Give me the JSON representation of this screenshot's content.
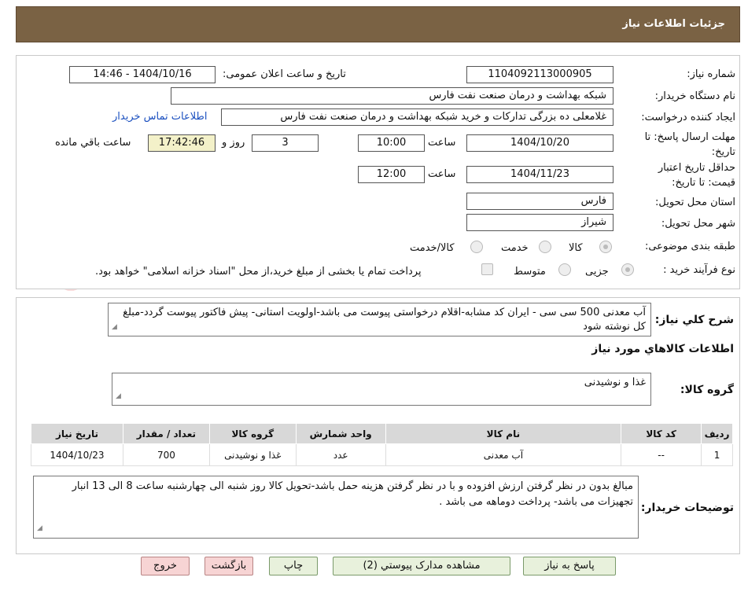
{
  "header": {
    "title": "جزئیات اطلاعات نیاز"
  },
  "form": {
    "need_number_label": "شماره نیاز:",
    "need_number": "1104092113000905",
    "announce_label": "تاریخ و ساعت اعلان عمومی:",
    "announce_value": "1404/10/16 - 14:46",
    "buyer_name_label": "نام دستگاه خریدار:",
    "buyer_name": "شبکه بهداشت و درمان صنعت نفت فارس",
    "creator_label": "ایجاد کننده درخواست:",
    "creator": "غلامعلی ده بزرگی تدارکات و خرید شبکه بهداشت و درمان صنعت نفت فارس",
    "contact_link": "اطلاعات تماس خریدار",
    "deadline_label_1": "مهلت ارسال پاسخ: تا",
    "deadline_label_2": "تاریخ:",
    "deadline_date": "1404/10/20",
    "time_label": "ساعت",
    "deadline_time": "10:00",
    "days_value": "3",
    "days_label": "روز و",
    "remaining_time": "17:42:46",
    "remaining_label": "ساعت باقي مانده",
    "validity_label_1": "حداقل تاریخ اعتبار",
    "validity_label_2": "قیمت: تا تاریخ:",
    "validity_date": "1404/11/23",
    "validity_time": "12:00",
    "province_label": "استان محل تحویل:",
    "province": "فارس",
    "city_label": "شهر محل تحویل:",
    "city": "شیراز",
    "category_label": "طبقه بندی موضوعی:",
    "category_options": [
      "کالا",
      "خدمت",
      "کالا/خدمت"
    ],
    "purchase_type_label": "نوع فرآیند خرید :",
    "purchase_options": [
      "جزیی",
      "متوسط"
    ],
    "treasury_note": "پرداخت تمام یا بخشی از مبلغ خرید،از محل \"اسناد خزانه اسلامی\" خواهد بود."
  },
  "summary": {
    "label": "شرح کلي نياز:",
    "text": "آب معدنی 500 سی سی - ایران کد مشابه-اقلام درخواستی پیوست می باشد-اولویت استانی- پیش فاکتور پیوست گردد-مبلغ کل نوشته شود"
  },
  "goods": {
    "section_title": "اطلاعات کالاهاي مورد نياز",
    "group_label": "گروه کالا:",
    "group_value": "غذا و نوشیدنی",
    "table": {
      "headers": [
        "رديف",
        "کد کالا",
        "نام کالا",
        "واحد شمارش",
        "گروه کالا",
        "تعداد / مقدار",
        "تاریخ نیاز"
      ],
      "rows": [
        [
          "1",
          "--",
          "آب معدنی",
          "عدد",
          "غذا و نوشیدنی",
          "700",
          "1404/10/23"
        ]
      ]
    }
  },
  "buyer_notes": {
    "label": "توضیحات خریدار:",
    "text": "مبالغ بدون در نظر گرفتن ارزش افزوده و با در نظر گرفتن هزینه حمل باشد-تحویل کالا روز شنبه الی چهارشنبه ساعت 8 الی 13 انبار تجهیزات می باشد- پرداخت دوماهه می باشد ."
  },
  "buttons": {
    "respond": "پاسخ به نیاز",
    "attachments": "مشاهده مدارک پیوستي (2)",
    "print": "چاپ",
    "back": "بازگشت",
    "exit": "خروج"
  },
  "watermark": {
    "text": "AriaTender.neT"
  },
  "colors": {
    "header_bg": "#7a6244",
    "link": "#1a4fbf",
    "remaining_bg": "#f3f1c9",
    "button_green": "#e8f1dc",
    "button_pink": "#f7d4d4"
  }
}
